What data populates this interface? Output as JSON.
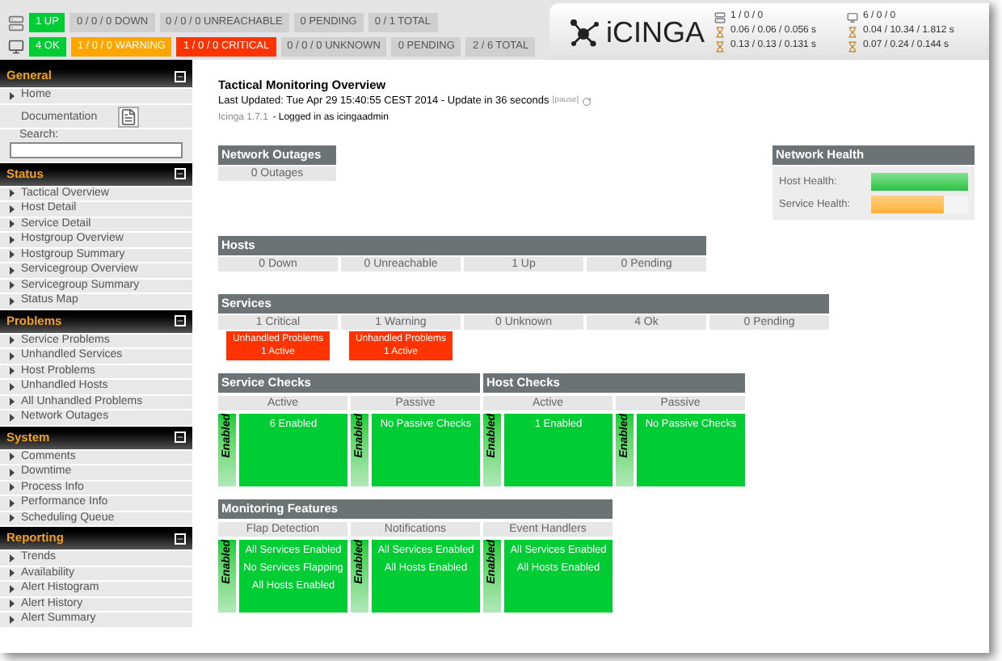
{
  "top_bar": {
    "host_totals": [
      {
        "label": "1 UP",
        "color": "#00cc33"
      },
      {
        "label": "0 / 0 / 0 DOWN",
        "color": "#cfcfcf"
      },
      {
        "label": "0 / 0 / 0 UNREACHABLE",
        "color": "#cfcfcf"
      },
      {
        "label": "0 PENDING",
        "color": "#cfcfcf"
      },
      {
        "label": "0 / 1 TOTAL",
        "color": "#cfcfcf"
      }
    ],
    "service_totals": [
      {
        "label": "4 OK",
        "color": "#00cc33"
      },
      {
        "label": "1 / 0 / 0 WARNING",
        "color": "#ffa500"
      },
      {
        "label": "1 / 0 / 0 CRITICAL",
        "color": "#ff3300"
      },
      {
        "label": "0 / 0 / 0 UNKNOWN",
        "color": "#cfcfcf"
      },
      {
        "label": "0 PENDING",
        "color": "#cfcfcf"
      },
      {
        "label": "2 / 6 TOTAL",
        "color": "#cfcfcf"
      }
    ],
    "logo": "iCINGA",
    "host_stats": [
      "1 / 0 / 0",
      "0.06 / 0.06 / 0.056 s",
      "0.13 / 0.13 / 0.131 s"
    ],
    "service_stats": [
      "6 / 0 / 0",
      "0.04 / 10.34 / 1.812 s",
      "0.07 / 0.24 / 0.144 s"
    ]
  },
  "sidebar": {
    "sections": [
      {
        "title": "General",
        "items": [
          "Home"
        ],
        "documentation": "Documentation",
        "search_label": "Search:"
      },
      {
        "title": "Status",
        "items": [
          "Tactical Overview",
          "Host Detail",
          "Service Detail",
          "Hostgroup Overview",
          "Hostgroup Summary",
          "Servicegroup Overview",
          "Servicegroup Summary",
          "Status Map"
        ]
      },
      {
        "title": "Problems",
        "items": [
          "Service Problems",
          "Unhandled Services",
          "Host Problems",
          "Unhandled Hosts",
          "All Unhandled Problems",
          "Network Outages"
        ]
      },
      {
        "title": "System",
        "items": [
          "Comments",
          "Downtime",
          "Process Info",
          "Performance Info",
          "Scheduling Queue"
        ]
      },
      {
        "title": "Reporting",
        "items": [
          "Trends",
          "Availability",
          "Alert Histogram",
          "Alert History",
          "Alert Summary"
        ]
      }
    ]
  },
  "header": {
    "title": "Tactical Monitoring Overview",
    "last_updated": "Last Updated: Tue Apr 29 15:40:55 CEST 2014 - Update in 36 seconds",
    "pause": "[pause]",
    "version": "Icinga 1.7.1",
    "login": " - Logged in as icingaadmin"
  },
  "network_outages": {
    "title": "Network Outages",
    "value": "0 Outages"
  },
  "network_health": {
    "title": "Network Health",
    "bars": [
      {
        "label": "Host Health:",
        "level": 1.0
      },
      {
        "label": "Service Health:",
        "level": 0.75
      }
    ]
  },
  "hosts": {
    "title": "Hosts",
    "cells": [
      {
        "label": "0 Down"
      },
      {
        "label": "0 Unreachable"
      },
      {
        "label": "1 Up"
      },
      {
        "label": "0 Pending"
      }
    ]
  },
  "services": {
    "title": "Services",
    "cells": [
      {
        "label": "1 Critical",
        "unhandled": [
          "Unhandled Problems",
          "1 Active"
        ]
      },
      {
        "label": "1 Warning",
        "unhandled": [
          "Unhandled Problems",
          "1 Active"
        ]
      },
      {
        "label": "0 Unknown"
      },
      {
        "label": "4 Ok"
      },
      {
        "label": "0 Pending"
      }
    ]
  },
  "check_panels": [
    {
      "title": "Service Checks",
      "columns": [
        {
          "label": "Active",
          "enabled": true,
          "state_label": "Enabled",
          "lines": [
            "6 Enabled"
          ]
        },
        {
          "label": "Passive",
          "enabled": true,
          "state_label": "Enabled",
          "lines": [
            "No Passive Checks"
          ]
        }
      ]
    },
    {
      "title": "Host Checks",
      "columns": [
        {
          "label": "Active",
          "enabled": true,
          "state_label": "Enabled",
          "lines": [
            "1 Enabled"
          ]
        },
        {
          "label": "Passive",
          "enabled": true,
          "state_label": "Enabled",
          "lines": [
            "No Passive Checks"
          ]
        }
      ]
    }
  ],
  "monitoring_features": {
    "title": "Monitoring Features",
    "columns": [
      {
        "label": "Flap Detection",
        "enabled": true,
        "state_label": "Enabled",
        "lines": [
          "All Services Enabled",
          "No Services Flapping",
          "All Hosts Enabled"
        ]
      },
      {
        "label": "Notifications",
        "enabled": true,
        "state_label": "Enabled",
        "lines": [
          "All Services Enabled",
          "All Hosts Enabled"
        ]
      },
      {
        "label": "Event Handlers",
        "enabled": true,
        "state_label": "Enabled",
        "lines": [
          "All Services Enabled",
          "All Hosts Enabled"
        ]
      }
    ]
  }
}
